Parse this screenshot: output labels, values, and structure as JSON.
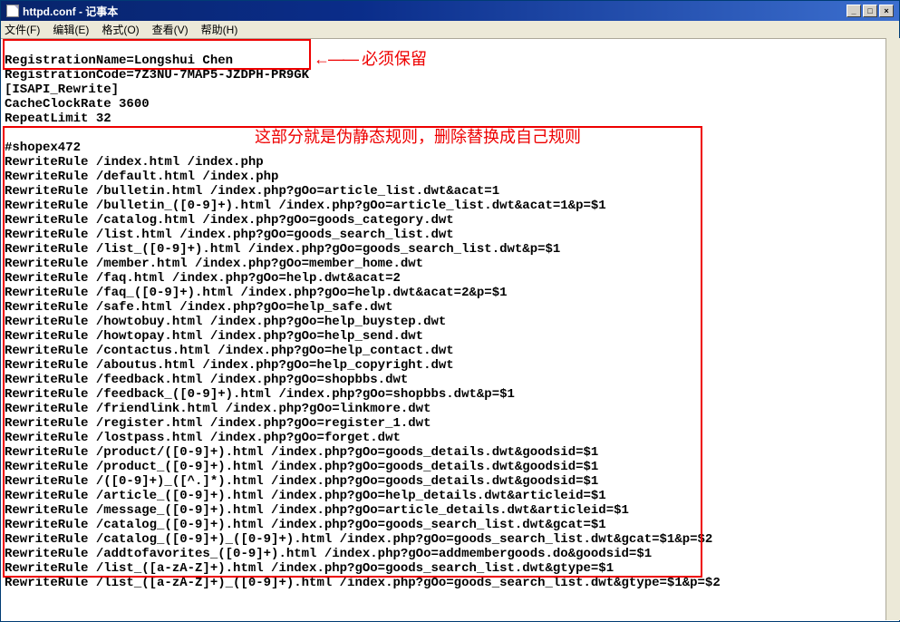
{
  "window": {
    "title": "httpd.conf - 记事本"
  },
  "menu": {
    "file": "文件(F)",
    "edit": "编辑(E)",
    "format": "格式(O)",
    "view": "查看(V)",
    "help": "帮助(H)"
  },
  "annotations": {
    "keep": "必须保留",
    "rules": "这部分就是伪静态规则，删除替换成自己规则"
  },
  "content": {
    "lines": [
      "RegistrationName=Longshui Chen",
      "RegistrationCode=7Z3NU-7MAP5-JZDPH-PR9GK",
      "[ISAPI_Rewrite]",
      "CacheClockRate 3600",
      "RepeatLimit 32",
      "",
      "#shopex472",
      "RewriteRule /index.html /index.php",
      "RewriteRule /default.html /index.php",
      "RewriteRule /bulletin.html /index.php?gOo=article_list.dwt&acat=1",
      "RewriteRule /bulletin_([0-9]+).html /index.php?gOo=article_list.dwt&acat=1&p=$1",
      "RewriteRule /catalog.html /index.php?gOo=goods_category.dwt",
      "RewriteRule /list.html /index.php?gOo=goods_search_list.dwt",
      "RewriteRule /list_([0-9]+).html /index.php?gOo=goods_search_list.dwt&p=$1",
      "RewriteRule /member.html /index.php?gOo=member_home.dwt",
      "RewriteRule /faq.html /index.php?gOo=help.dwt&acat=2",
      "RewriteRule /faq_([0-9]+).html /index.php?gOo=help.dwt&acat=2&p=$1",
      "RewriteRule /safe.html /index.php?gOo=help_safe.dwt",
      "RewriteRule /howtobuy.html /index.php?gOo=help_buystep.dwt",
      "RewriteRule /howtopay.html /index.php?gOo=help_send.dwt",
      "RewriteRule /contactus.html /index.php?gOo=help_contact.dwt",
      "RewriteRule /aboutus.html /index.php?gOo=help_copyright.dwt",
      "RewriteRule /feedback.html /index.php?gOo=shopbbs.dwt",
      "RewriteRule /feedback_([0-9]+).html /index.php?gOo=shopbbs.dwt&p=$1",
      "RewriteRule /friendlink.html /index.php?gOo=linkmore.dwt",
      "RewriteRule /register.html /index.php?gOo=register_1.dwt",
      "RewriteRule /lostpass.html /index.php?gOo=forget.dwt",
      "RewriteRule /product/([0-9]+).html /index.php?gOo=goods_details.dwt&goodsid=$1",
      "RewriteRule /product_([0-9]+).html /index.php?gOo=goods_details.dwt&goodsid=$1",
      "RewriteRule /([0-9]+)_([^.]*).html /index.php?gOo=goods_details.dwt&goodsid=$1",
      "RewriteRule /article_([0-9]+).html /index.php?gOo=help_details.dwt&articleid=$1",
      "RewriteRule /message_([0-9]+).html /index.php?gOo=article_details.dwt&articleid=$1",
      "RewriteRule /catalog_([0-9]+).html /index.php?gOo=goods_search_list.dwt&gcat=$1",
      "RewriteRule /catalog_([0-9]+)_([0-9]+).html /index.php?gOo=goods_search_list.dwt&gcat=$1&p=$2",
      "RewriteRule /addtofavorites_([0-9]+).html /index.php?gOo=addmembergoods.do&goodsid=$1",
      "RewriteRule /list_([a-zA-Z]+).html /index.php?gOo=goods_search_list.dwt&gtype=$1",
      "RewriteRule /list_([a-zA-Z]+)_([0-9]+).html /index.php?gOo=goods_search_list.dwt&gtype=$1&p=$2"
    ]
  }
}
